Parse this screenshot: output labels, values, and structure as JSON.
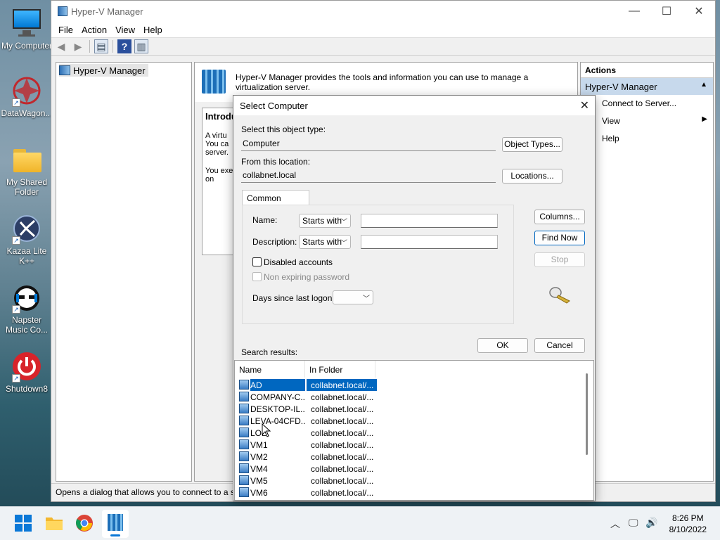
{
  "desktop": {
    "icons": [
      {
        "label": "My Computer",
        "icon": "monitor-icon"
      },
      {
        "label": "DataWagon...",
        "icon": "datawagon-icon"
      },
      {
        "label": "My Shared Folder",
        "icon": "folder-icon"
      },
      {
        "label": "Kazaa Lite K++",
        "icon": "kazaa-icon"
      },
      {
        "label": "Napster Music Co...",
        "icon": "napster-icon"
      },
      {
        "label": "Shutdown8",
        "icon": "power-icon"
      }
    ]
  },
  "window": {
    "title": "Hyper-V Manager",
    "menu": [
      "File",
      "Action",
      "View",
      "Help"
    ],
    "tree": {
      "root": "Hyper-V Manager"
    },
    "banner_text": "Hyper-V Manager provides the tools and information you can use to manage a virtualization server.",
    "intro": {
      "heading": "Introdu",
      "para1": "A virtu You ca server.",
      "para2": "You exe on"
    },
    "actions": {
      "header": "Actions",
      "section": "Hyper-V Manager",
      "items": [
        "Connect to Server...",
        "View",
        "Help"
      ]
    },
    "status": "Opens a dialog that allows you to connect to a s"
  },
  "dialog": {
    "title": "Select Computer",
    "object_type_label": "Select this object type:",
    "object_type_value": "Computer",
    "object_types_button": "Object Types...",
    "location_label": "From this location:",
    "location_value": "collabnet.local",
    "locations_button": "Locations...",
    "tab": "Common Queries",
    "name_label": "Name:",
    "name_mode": "Starts with",
    "description_label": "Description:",
    "description_mode": "Starts with",
    "disabled_accounts": "Disabled accounts",
    "non_expiring": "Non expiring password",
    "days_label": "Days since last logon:",
    "columns_button": "Columns...",
    "find_now_button": "Find Now",
    "stop_button": "Stop",
    "ok_button": "OK",
    "cancel_button": "Cancel",
    "results_label": "Search results:",
    "columns": [
      "Name",
      "In Folder"
    ],
    "rows": [
      {
        "name": "AD",
        "folder": "collabnet.local/...",
        "selected": true
      },
      {
        "name": "COMPANY-C...",
        "folder": "collabnet.local/..."
      },
      {
        "name": "DESKTOP-IL...",
        "folder": "collabnet.local/..."
      },
      {
        "name": "LEVA-04CFD...",
        "folder": "collabnet.local/..."
      },
      {
        "name": "LOL",
        "folder": "collabnet.local/..."
      },
      {
        "name": "VM1",
        "folder": "collabnet.local/..."
      },
      {
        "name": "VM2",
        "folder": "collabnet.local/..."
      },
      {
        "name": "VM4",
        "folder": "collabnet.local/..."
      },
      {
        "name": "VM5",
        "folder": "collabnet.local/..."
      },
      {
        "name": "VM6",
        "folder": "collabnet.local/..."
      }
    ]
  },
  "taskbar": {
    "time": "8:26 PM",
    "date": "8/10/2022"
  },
  "colors": {
    "accent": "#0067c0",
    "actions_section_bg": "#c7d9ec"
  }
}
